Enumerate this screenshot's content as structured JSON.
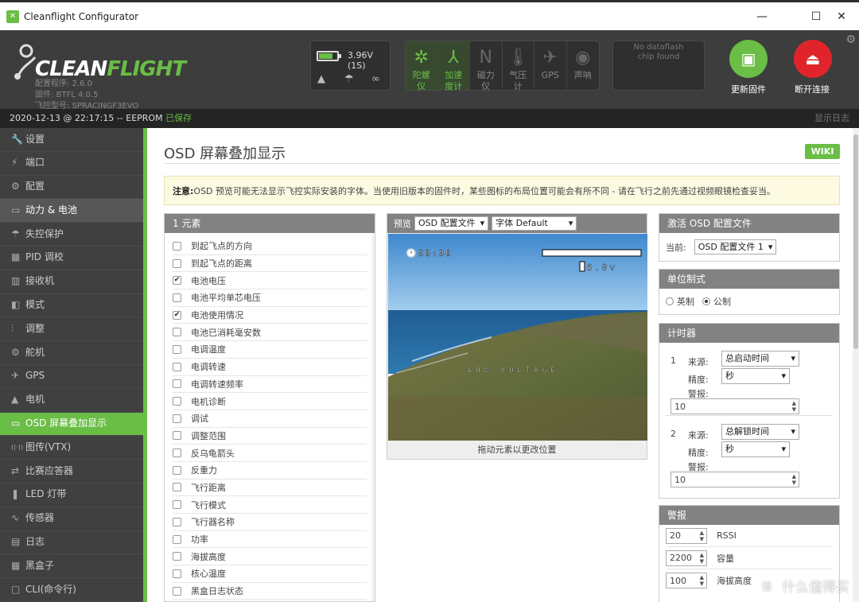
{
  "window": {
    "title": "Cleanflight Configurator",
    "minimize": "—",
    "maximize": "☐",
    "close": "✕"
  },
  "header": {
    "logo": {
      "part1": "CLEAN",
      "part2": "FLIGHT"
    },
    "versions": [
      "配置程序: 2.6.0",
      "固件: BTFL 4.0.5",
      "飞控型号: SPRACINGF3EVO"
    ],
    "battery_voltage": "3.96V (1S)",
    "battery_fill_fraction": 0.75,
    "sensors": [
      {
        "label": "陀螺\n仪",
        "icon": "gyro-icon",
        "glyph": "✲",
        "active": true
      },
      {
        "label": "加速\n度计",
        "icon": "accel-icon",
        "glyph": "⅄",
        "active": true
      },
      {
        "label": "磁力\n仪",
        "icon": "compass-icon",
        "glyph": "N",
        "active": false
      },
      {
        "label": "气压\n计",
        "icon": "barometer-icon",
        "glyph": "🌡",
        "active": false
      },
      {
        "label": "GPS",
        "icon": "gps-icon",
        "glyph": "✈",
        "active": false
      },
      {
        "label": "声呐",
        "icon": "sonar-icon",
        "glyph": "◉",
        "active": false
      }
    ],
    "dataflash": "No dataflash\nchip found",
    "update_firmware": "更新固件",
    "disconnect": "断开连接",
    "colors": {
      "green": "#6abd45",
      "red": "#e1242b"
    }
  },
  "statusbar": {
    "text": "2020-12-13 @ 22:17:15 -- EEPROM ",
    "saved": "已保存",
    "show_log": "显示日志"
  },
  "sidebar": {
    "items": [
      {
        "label": "设置",
        "icon": "wrench-icon",
        "glyph": "🔧"
      },
      {
        "label": "端口",
        "icon": "plug-icon",
        "glyph": "⚡"
      },
      {
        "label": "配置",
        "icon": "gear-icon",
        "glyph": "⚙"
      },
      {
        "label": "动力 & 电池",
        "icon": "battery-icon",
        "glyph": "▭",
        "state": "hover"
      },
      {
        "label": "失控保护",
        "icon": "failsafe-icon",
        "glyph": "☂"
      },
      {
        "label": "PID 调校",
        "icon": "pid-icon",
        "glyph": "▦"
      },
      {
        "label": "接收机",
        "icon": "receiver-icon",
        "glyph": "▥"
      },
      {
        "label": "模式",
        "icon": "modes-icon",
        "glyph": "◧"
      },
      {
        "label": "调整",
        "icon": "adjust-icon",
        "glyph": "⫶"
      },
      {
        "label": "舵机",
        "icon": "servo-icon",
        "glyph": "⚙"
      },
      {
        "label": "GPS",
        "icon": "gps-icon",
        "glyph": "✈"
      },
      {
        "label": "电机",
        "icon": "motor-icon",
        "glyph": "▲"
      },
      {
        "label": "OSD 屏幕叠加显示",
        "icon": "osd-icon",
        "glyph": "▭",
        "state": "selected"
      },
      {
        "label": "图传(VTX)",
        "icon": "vtx-icon",
        "glyph": "((·))"
      },
      {
        "label": "比赛应答器",
        "icon": "transponder-icon",
        "glyph": "⇄"
      },
      {
        "label": "LED 灯带",
        "icon": "led-icon",
        "glyph": "❚"
      },
      {
        "label": "传感器",
        "icon": "sensors-icon",
        "glyph": "∿"
      },
      {
        "label": "日志",
        "icon": "log-icon",
        "glyph": "▤"
      },
      {
        "label": "黑盒子",
        "icon": "blackbox-icon",
        "glyph": "▦"
      },
      {
        "label": "CLI(命令行)",
        "icon": "cli-icon",
        "glyph": "▢"
      }
    ]
  },
  "main": {
    "title": "OSD 屏幕叠加显示",
    "wiki": "WIKI",
    "note_bold": "注意:",
    "note": "OSD 预览可能无法显示飞控实际安装的字体。当使用旧版本的固件时，某些图标的布局位置可能会有所不同 - 请在飞行之前先通过视频眼镜检查妥当。",
    "elements": {
      "header": "1  元素",
      "items": [
        {
          "label": "到起飞点的方向",
          "checked": false
        },
        {
          "label": "到起飞点的距离",
          "checked": false
        },
        {
          "label": "电池电压",
          "checked": true
        },
        {
          "label": "电池平均单芯电压",
          "checked": false
        },
        {
          "label": "电池使用情况",
          "checked": true
        },
        {
          "label": "电池已消耗毫安数",
          "checked": false
        },
        {
          "label": "电调温度",
          "checked": false
        },
        {
          "label": "电调转速",
          "checked": false
        },
        {
          "label": "电调转速频率",
          "checked": false
        },
        {
          "label": "电机诊断",
          "checked": false
        },
        {
          "label": "调试",
          "checked": false
        },
        {
          "label": "调整范围",
          "checked": false
        },
        {
          "label": "反乌龟箭头",
          "checked": false
        },
        {
          "label": "反重力",
          "checked": false
        },
        {
          "label": "飞行距离",
          "checked": false
        },
        {
          "label": "飞行模式",
          "checked": false
        },
        {
          "label": "飞行器名称",
          "checked": false
        },
        {
          "label": "功率",
          "checked": false
        },
        {
          "label": "海拔高度",
          "checked": false
        },
        {
          "label": "核心温度",
          "checked": false
        },
        {
          "label": "黑盒日志状态",
          "checked": false
        }
      ]
    },
    "preview": {
      "label": "预览",
      "profile_select": "OSD 配置文件",
      "font_select": "字体 Default",
      "osd_timer": "🕐00:00",
      "osd_voltage": "16.8v",
      "osd_warning": "LOW VOLTAGE",
      "footer": "拖动元素以更改位置"
    },
    "active_profile": {
      "header": "激活 OSD 配置文件",
      "current_label": "当前:",
      "current_value": "OSD 配置文件 1"
    },
    "units": {
      "header": "单位制式",
      "imperial": "英制",
      "metric": "公制",
      "selected": "metric"
    },
    "timers": {
      "header": "计时器",
      "items": [
        {
          "index": "1",
          "source_label": "来源:",
          "source": "总启动时间",
          "precision_label": "精度:",
          "precision": "秒",
          "alarm_label": "警报:",
          "alarm": "10"
        },
        {
          "index": "2",
          "source_label": "来源:",
          "source": "总解锁时间",
          "precision_label": "精度:",
          "precision": "秒",
          "alarm_label": "警报:",
          "alarm": "10"
        }
      ]
    },
    "alarms": {
      "header": "警报",
      "items": [
        {
          "value": "20",
          "label": "RSSI"
        },
        {
          "value": "2200",
          "label": "容量"
        },
        {
          "value": "100",
          "label": "海拔高度"
        }
      ]
    }
  },
  "watermark": {
    "badge": "值",
    "text": "什么值得买"
  }
}
